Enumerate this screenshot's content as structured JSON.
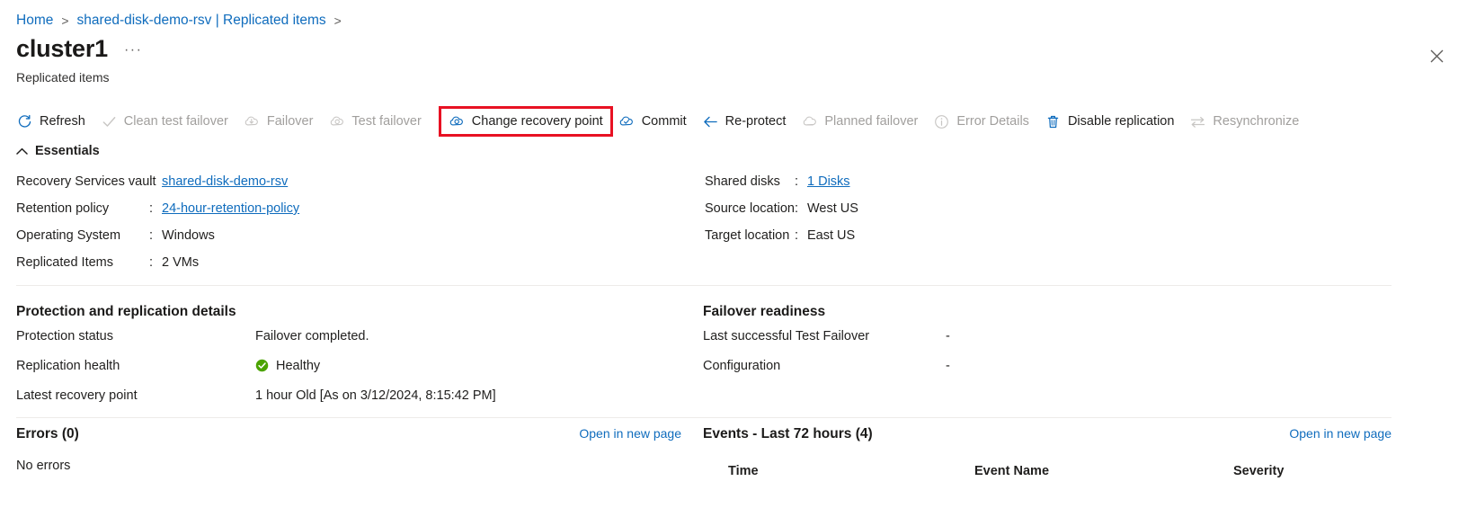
{
  "breadcrumb": {
    "items": [
      {
        "label": "Home"
      },
      {
        "label": "shared-disk-demo-rsv | Replicated items"
      }
    ],
    "separator": ">"
  },
  "header": {
    "title": "cluster1",
    "ellipsis": "···",
    "subtitle": "Replicated items",
    "close_icon": "close-icon"
  },
  "commandbar": {
    "items": [
      {
        "label": "Refresh",
        "icon": "refresh-icon",
        "enabled": true,
        "highlighted": false
      },
      {
        "label": "Clean test failover",
        "icon": "checkmark-icon",
        "enabled": false,
        "highlighted": false
      },
      {
        "label": "Failover",
        "icon": "cloud-failover-icon",
        "enabled": false,
        "highlighted": false
      },
      {
        "label": "Test failover",
        "icon": "cloud-test-icon",
        "enabled": false,
        "highlighted": false
      },
      {
        "label": "Change recovery point",
        "icon": "cloud-recovery-icon",
        "enabled": true,
        "highlighted": true
      },
      {
        "label": "Commit",
        "icon": "cloud-commit-icon",
        "enabled": true,
        "highlighted": false
      },
      {
        "label": "Re-protect",
        "icon": "arrow-left-icon",
        "enabled": true,
        "highlighted": false
      },
      {
        "label": "Planned failover",
        "icon": "cloud-planned-icon",
        "enabled": false,
        "highlighted": false
      },
      {
        "label": "Error Details",
        "icon": "info-circle-icon",
        "enabled": false,
        "highlighted": false
      },
      {
        "label": "Disable replication",
        "icon": "trash-icon",
        "enabled": true,
        "highlighted": false
      },
      {
        "label": "Resynchronize",
        "icon": "resync-arrows-icon",
        "enabled": false,
        "highlighted": false
      }
    ],
    "highlight_color": "#e81123"
  },
  "essentials": {
    "toggle_label": "Essentials",
    "toggle_icon": "chevron-up-icon",
    "left": [
      {
        "key": "Recovery Services vault",
        "colon": ":",
        "value": "shared-disk-demo-rsv",
        "link": true
      },
      {
        "key": "Retention policy",
        "colon": ":",
        "value": "24-hour-retention-policy",
        "link": true
      },
      {
        "key": "Operating System",
        "colon": ":",
        "value": "Windows",
        "link": false
      },
      {
        "key": "Replicated Items",
        "colon": ":",
        "value": "2 VMs",
        "link": false
      }
    ],
    "right": [
      {
        "key": "Shared disks",
        "colon": ":",
        "value": "1 Disks",
        "link": true
      },
      {
        "key": "Source location",
        "colon": ":",
        "value": "West US",
        "link": false
      },
      {
        "key": "Target location",
        "colon": ":",
        "value": "East US",
        "link": false
      }
    ]
  },
  "details": {
    "protection": {
      "title": "Protection and replication details",
      "rows": [
        {
          "key": "Protection status",
          "value": "Failover completed.",
          "status_icon": ""
        },
        {
          "key": "Replication health",
          "value": "Healthy",
          "status_icon": "healthy-check-icon"
        },
        {
          "key": "Latest recovery point",
          "value": "1 hour Old [As on 3/12/2024, 8:15:42 PM]",
          "status_icon": ""
        }
      ],
      "healthy_color": "#4aa300"
    },
    "readiness": {
      "title": "Failover readiness",
      "rows": [
        {
          "key": "Last successful Test Failover",
          "value": "-"
        },
        {
          "key": "Configuration",
          "value": "-"
        }
      ]
    }
  },
  "panels": {
    "errors": {
      "title": "Errors (0)",
      "open_link": "Open in new page",
      "body": "No errors"
    },
    "events": {
      "title": "Events - Last 72 hours (4)",
      "open_link": "Open in new page",
      "columns": [
        "Time",
        "Event Name",
        "Severity"
      ]
    }
  },
  "colors": {
    "link": "#0f6cbd",
    "text": "#201f1e",
    "disabled": "#a19f9d",
    "divider": "#edebe9"
  }
}
